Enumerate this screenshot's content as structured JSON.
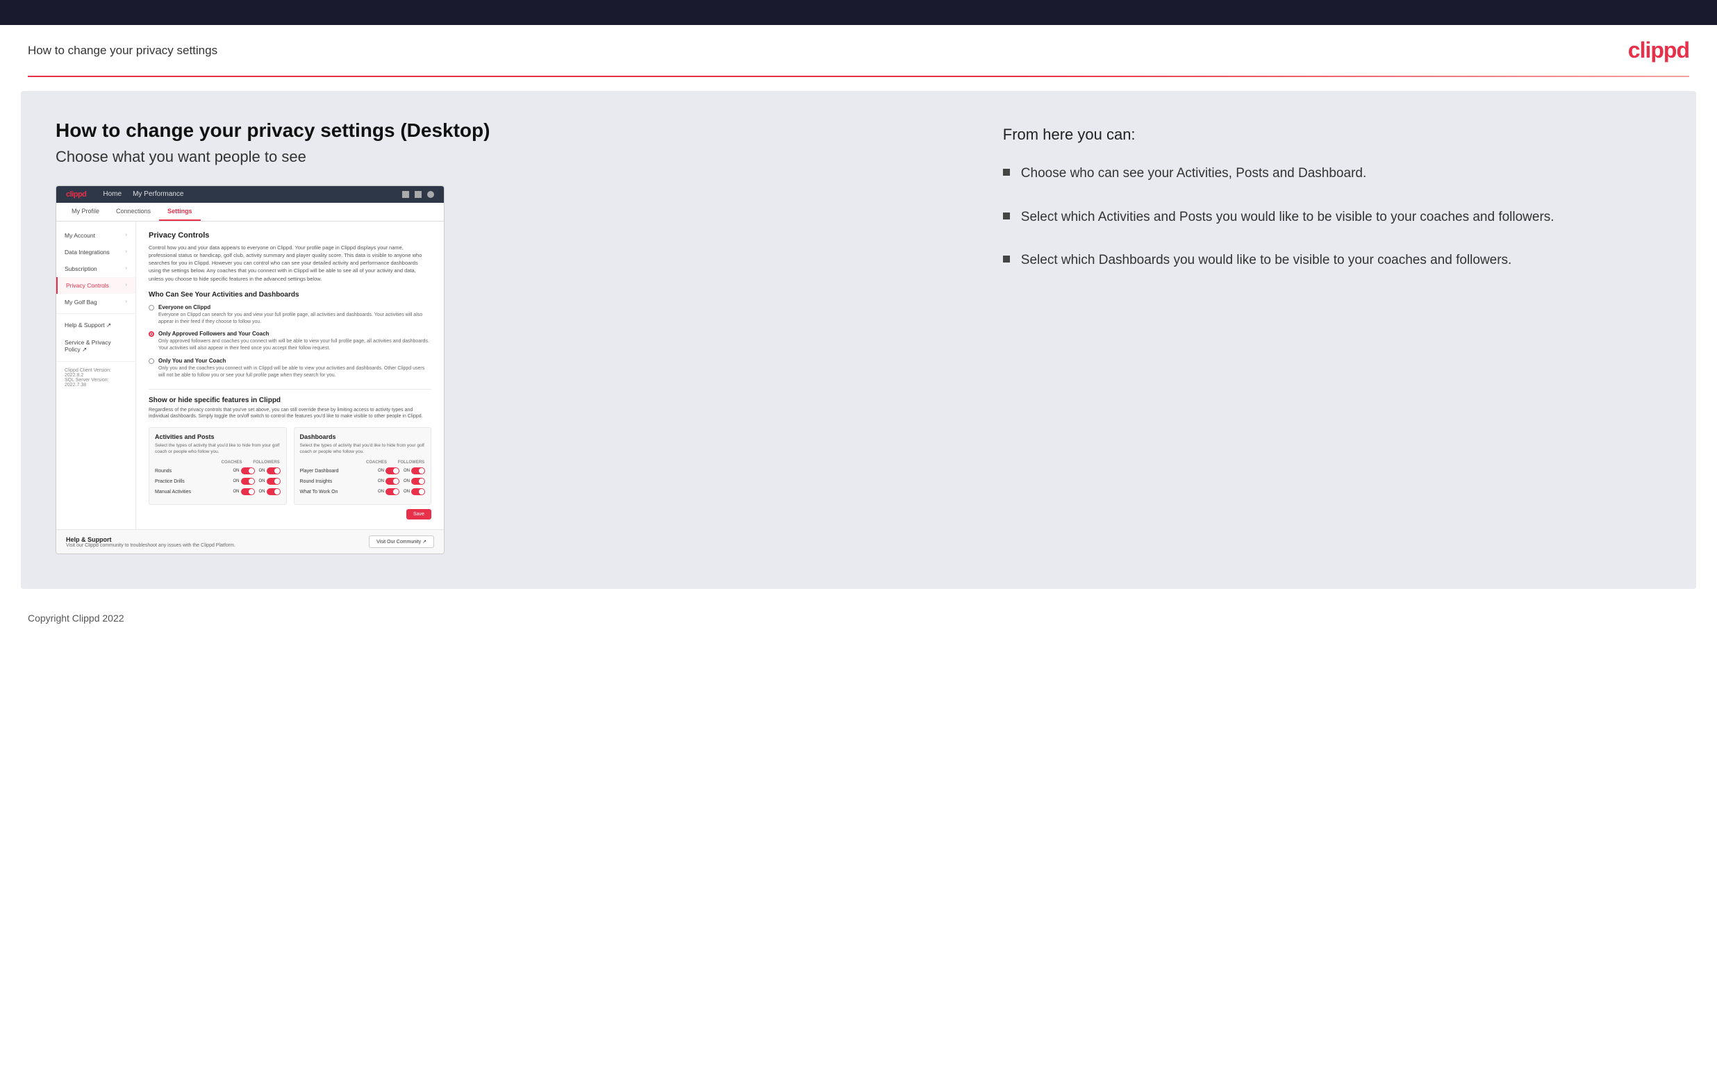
{
  "header": {
    "title": "How to change your privacy settings",
    "logo": "clippd"
  },
  "page": {
    "heading": "How to change your privacy settings (Desktop)",
    "subheading": "Choose what you want people to see"
  },
  "mockup": {
    "navbar": {
      "logo": "clippd",
      "items": [
        "Home",
        "My Performance"
      ]
    },
    "tabs": [
      {
        "label": "My Profile",
        "active": false
      },
      {
        "label": "Connections",
        "active": false
      },
      {
        "label": "Settings",
        "active": true
      }
    ],
    "sidebar": {
      "items": [
        {
          "label": "My Account",
          "active": false
        },
        {
          "label": "Data Integrations",
          "active": false
        },
        {
          "label": "Subscription",
          "active": false
        },
        {
          "label": "Privacy Controls",
          "active": true
        },
        {
          "label": "My Golf Bag",
          "active": false
        },
        {
          "label": "Help & Support",
          "active": false
        },
        {
          "label": "Service & Privacy Policy",
          "active": false
        }
      ],
      "version": "Clippd Client Version: 2022.8.2",
      "db_version": "SQL Server Version: 2022.7.38"
    },
    "main": {
      "privacy_controls_title": "Privacy Controls",
      "privacy_controls_desc": "Control how you and your data appears to everyone on Clippd. Your profile page in Clippd displays your name, professional status or handicap, golf club, activity summary and player quality score. This data is visible to anyone who searches for you in Clippd. However you can control who can see your detailed activity and performance dashboards using the settings below. Any coaches that you connect with in Clippd will be able to see all of your activity and data, unless you choose to hide specific features in the advanced settings below.",
      "who_can_see_title": "Who Can See Your Activities and Dashboards",
      "radio_options": [
        {
          "label": "Everyone on Clippd",
          "desc": "Everyone on Clippd can search for you and view your full profile page, all activities and dashboards. Your activities will also appear in their feed if they choose to follow you.",
          "selected": false
        },
        {
          "label": "Only Approved Followers and Your Coach",
          "desc": "Only approved followers and coaches you connect with will be able to view your full profile page, all activities and dashboards. Your activities will also appear in their feed once you accept their follow request.",
          "selected": true
        },
        {
          "label": "Only You and Your Coach",
          "desc": "Only you and the coaches you connect with in Clippd will be able to view your activities and dashboards. Other Clippd users will not be able to follow you or see your full profile page when they search for you.",
          "selected": false
        }
      ],
      "show_hide_title": "Show or hide specific features in Clippd",
      "show_hide_desc": "Regardless of the privacy controls that you've set above, you can still override these by limiting access to activity types and individual dashboards. Simply toggle the on/off switch to control the features you'd like to make visible to other people in Clippd.",
      "activities_posts": {
        "title": "Activities and Posts",
        "desc": "Select the types of activity that you'd like to hide from your golf coach or people who follow you.",
        "columns": [
          "COACHES",
          "FOLLOWERS"
        ],
        "rows": [
          {
            "label": "Rounds",
            "coaches": "ON",
            "followers": "ON"
          },
          {
            "label": "Practice Drills",
            "coaches": "ON",
            "followers": "ON"
          },
          {
            "label": "Manual Activities",
            "coaches": "ON",
            "followers": "ON"
          }
        ]
      },
      "dashboards": {
        "title": "Dashboards",
        "desc": "Select the types of activity that you'd like to hide from your golf coach or people who follow you.",
        "columns": [
          "COACHES",
          "FOLLOWERS"
        ],
        "rows": [
          {
            "label": "Player Dashboard",
            "coaches": "ON",
            "followers": "ON"
          },
          {
            "label": "Round Insights",
            "coaches": "ON",
            "followers": "ON"
          },
          {
            "label": "What To Work On",
            "coaches": "ON",
            "followers": "ON"
          }
        ]
      },
      "save_label": "Save"
    },
    "help": {
      "title": "Help & Support",
      "desc": "Visit our Clippd community to troubleshoot any issues with the Clippd Platform.",
      "button": "Visit Our Community"
    }
  },
  "right_panel": {
    "from_here": "From here you can:",
    "bullets": [
      "Choose who can see your Activities, Posts and Dashboard.",
      "Select which Activities and Posts you would like to be visible to your coaches and followers.",
      "Select which Dashboards you would like to be visible to your coaches and followers."
    ]
  },
  "footer": {
    "copyright": "Copyright Clippd 2022"
  }
}
